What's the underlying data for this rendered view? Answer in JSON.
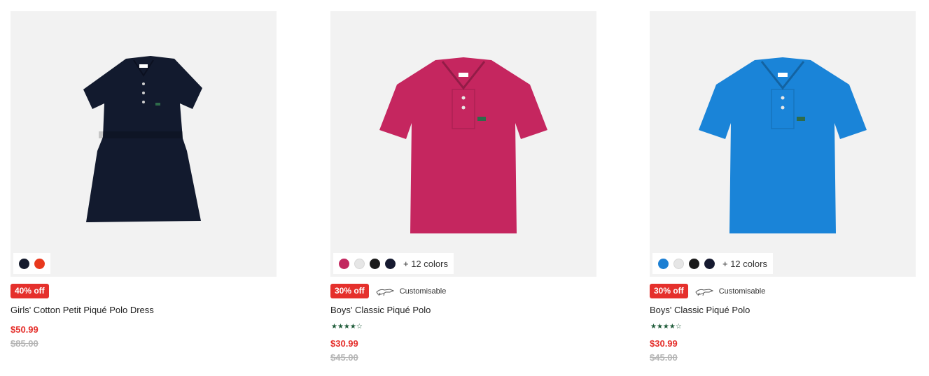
{
  "products": [
    {
      "name": "Girls' Cotton Petit Piqué Polo Dress",
      "discount": "40% off",
      "price": "$50.99",
      "old_price": "$85.00",
      "swatches": [
        "#141a2c",
        "#e8381d"
      ],
      "more_colors": "",
      "customisable": "",
      "rating": "",
      "garment_color": "#121a2e",
      "garment_type": "dress"
    },
    {
      "name": "Boys' Classic Piqué Polo",
      "discount": "30% off",
      "price": "$30.99",
      "old_price": "$45.00",
      "swatches": [
        "#c2285f",
        "#e6e6e6",
        "#1b1b1b",
        "#161a30"
      ],
      "more_colors": "+ 12 colors",
      "customisable": "Customisable",
      "rating": "★★★★☆",
      "garment_color": "#c5265f",
      "garment_type": "polo"
    },
    {
      "name": "Boys' Classic Piqué Polo",
      "discount": "30% off",
      "price": "$30.99",
      "old_price": "$45.00",
      "swatches": [
        "#1c7fd3",
        "#e6e6e6",
        "#1b1b1b",
        "#161a30"
      ],
      "more_colors": "+ 12 colors",
      "customisable": "Customisable",
      "rating": "★★★★☆",
      "garment_color": "#1a84d8",
      "garment_type": "polo"
    }
  ]
}
